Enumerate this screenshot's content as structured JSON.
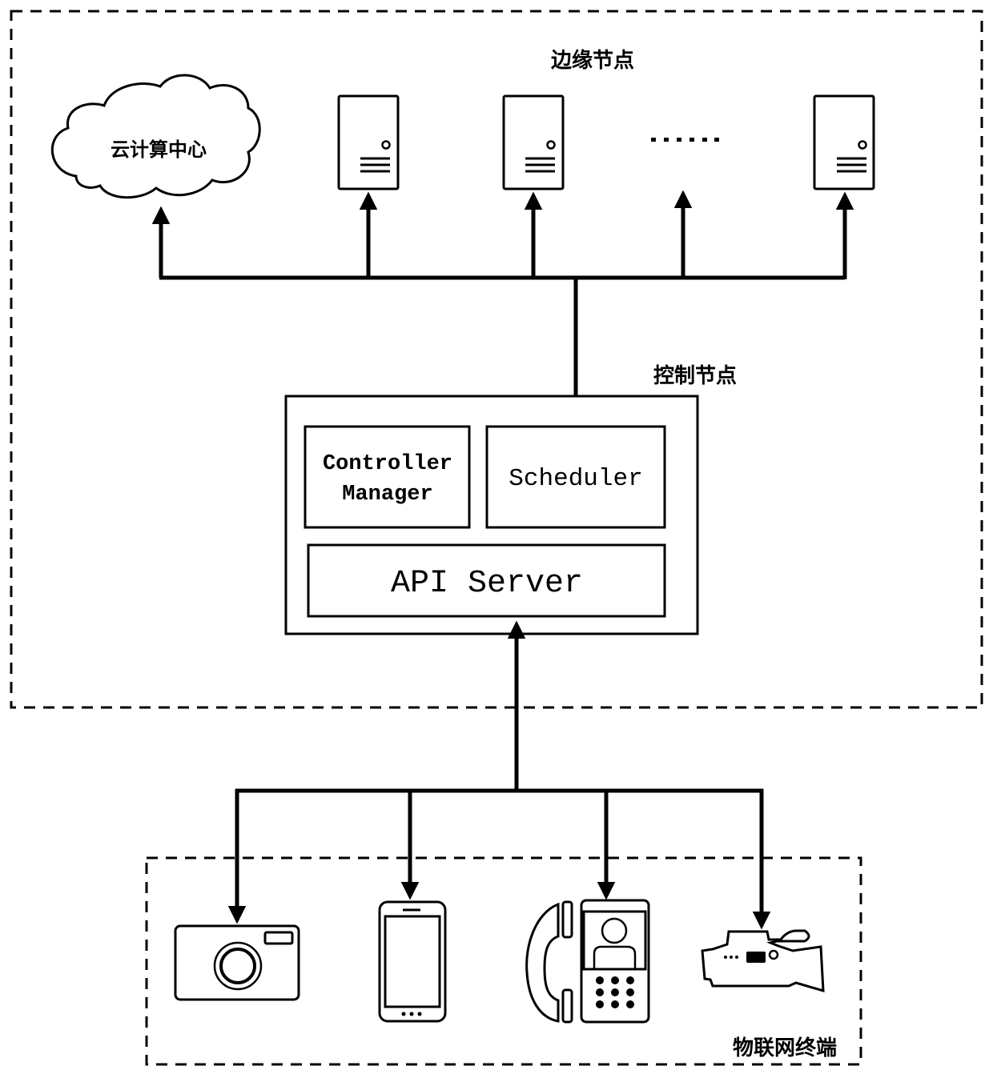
{
  "diagram": {
    "edge_region": {
      "label": "边缘节点",
      "cloud_label": "云计算中心",
      "ellipsis": "……",
      "server_count": 3
    },
    "control_node": {
      "label": "控制节点",
      "components": {
        "controller_manager_line1": "Controller",
        "controller_manager_line2": "Manager",
        "scheduler": "Scheduler",
        "api_server": "API Server"
      }
    },
    "iot_region": {
      "label": "物联网终端",
      "devices": [
        "camera",
        "smartphone",
        "video-phone",
        "video-camera"
      ]
    },
    "colors": {
      "stroke": "#000000",
      "background": "#ffffff"
    }
  }
}
